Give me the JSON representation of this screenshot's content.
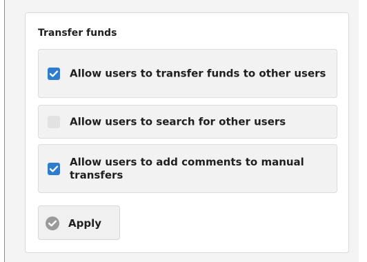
{
  "section": {
    "title": "Transfer funds"
  },
  "options": [
    {
      "label": "Allow users to transfer funds to other users",
      "checked": true
    },
    {
      "label": "Allow users to search for other users",
      "checked": false
    },
    {
      "label": "Allow users to add comments to manual transfers",
      "checked": true
    }
  ],
  "apply": {
    "label": "Apply",
    "icon": "check-circle-icon"
  },
  "colors": {
    "checkbox_checked": "#2b7cd3",
    "checkbox_unchecked": "#e2e2e2",
    "option_background": "#f2f2f2",
    "apply_icon": "#9a9a9a"
  }
}
